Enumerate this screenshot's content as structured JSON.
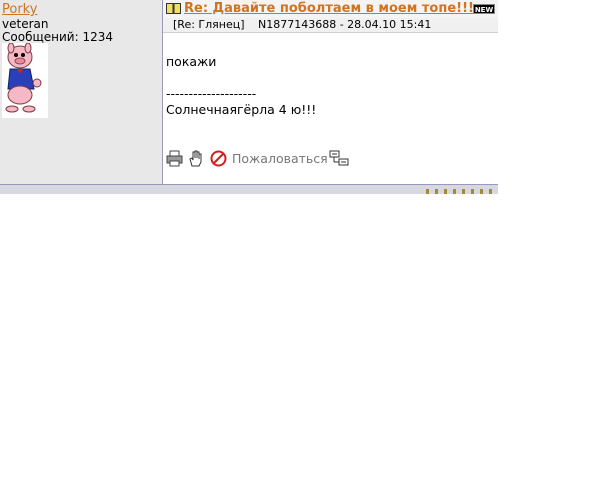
{
  "author": {
    "username": "Porky",
    "rank": "veteran",
    "post_count": "Сообщений: 1234",
    "avatar_icon": "porky-pig-avatar"
  },
  "post": {
    "title": "Re: Давайте поболтаем в моем топе!!!",
    "new_badge": "NEW",
    "reply_to": "[Re: Глянец]",
    "info": "N1877143688 - 28.04.10 15:41",
    "body": "покажи\n\n--------------------\nСолнечнаягёрла 4 ю!!!",
    "complain_label": "Пожаловаться"
  },
  "icons": {
    "title": "book-icon",
    "print": "printer-icon",
    "quote": "hand-icon",
    "ignore": "ignore-icon",
    "extra": "message-tree-icon"
  },
  "colors": {
    "link": "#d0741f",
    "author_bg": "#e8e8e8"
  }
}
